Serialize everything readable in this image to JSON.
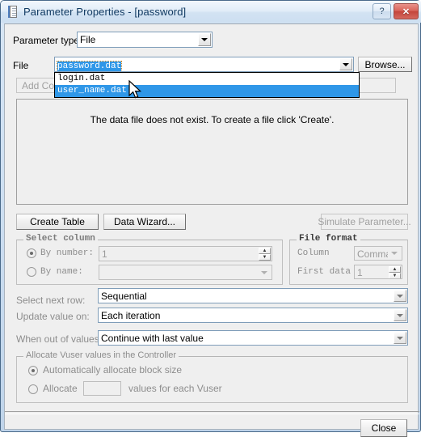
{
  "window": {
    "title": "Parameter Properties - [password]",
    "icon": "parameter-file-icon",
    "help_label": "?",
    "close_label": "✕"
  },
  "parameter_type": {
    "label": "Parameter type:",
    "value": "File"
  },
  "file_row": {
    "label": "File",
    "value": "password.dat",
    "browse_label": "Browse...",
    "dropdown_open": true,
    "options": [
      {
        "label": "login.dat",
        "selected": false
      },
      {
        "label": "user_name.dat",
        "selected": true
      }
    ]
  },
  "column_buttons": [
    {
      "label": "Add Column",
      "enabled": false
    },
    {
      "label": "",
      "enabled": false
    },
    {
      "label": "",
      "enabled": false
    },
    {
      "label": "",
      "enabled": false
    }
  ],
  "data_pane": {
    "message": "The data file does not exist. To create a file click 'Create'."
  },
  "action_buttons": {
    "create_table": "Create Table",
    "data_wizard": "Data Wizard...",
    "simulate_parameter": "Simulate Parameter..."
  },
  "select_column": {
    "title": "Select column",
    "by_number_label": "By number:",
    "by_number_value": "1",
    "by_number_selected": true,
    "by_name_label": "By name:",
    "by_name_value": "",
    "by_name_selected": false
  },
  "file_format": {
    "title": "File format",
    "column_label": "Column",
    "column_value": "Comma",
    "first_data_label": "First data",
    "first_data_value": "1"
  },
  "rows": {
    "select_next_row_label": "Select next row:",
    "select_next_row_value": "Sequential",
    "update_value_on_label": "Update value on:",
    "update_value_on_value": "Each iteration",
    "when_out_of_values_label": "When out of values:",
    "when_out_of_values_value": "Continue with last value"
  },
  "allocate": {
    "title": "Allocate Vuser values in the Controller",
    "auto_label": "Automatically allocate block size",
    "auto_selected": true,
    "manual_label_prefix": "Allocate",
    "manual_value": "",
    "manual_label_suffix": "values for each Vuser",
    "manual_selected": false
  },
  "footer": {
    "close_label": "Close"
  },
  "colors": {
    "highlight": "#2f97e8",
    "title_text": "#123b63",
    "dialog_bg": "#efefef",
    "close_button": "#c4453c"
  }
}
